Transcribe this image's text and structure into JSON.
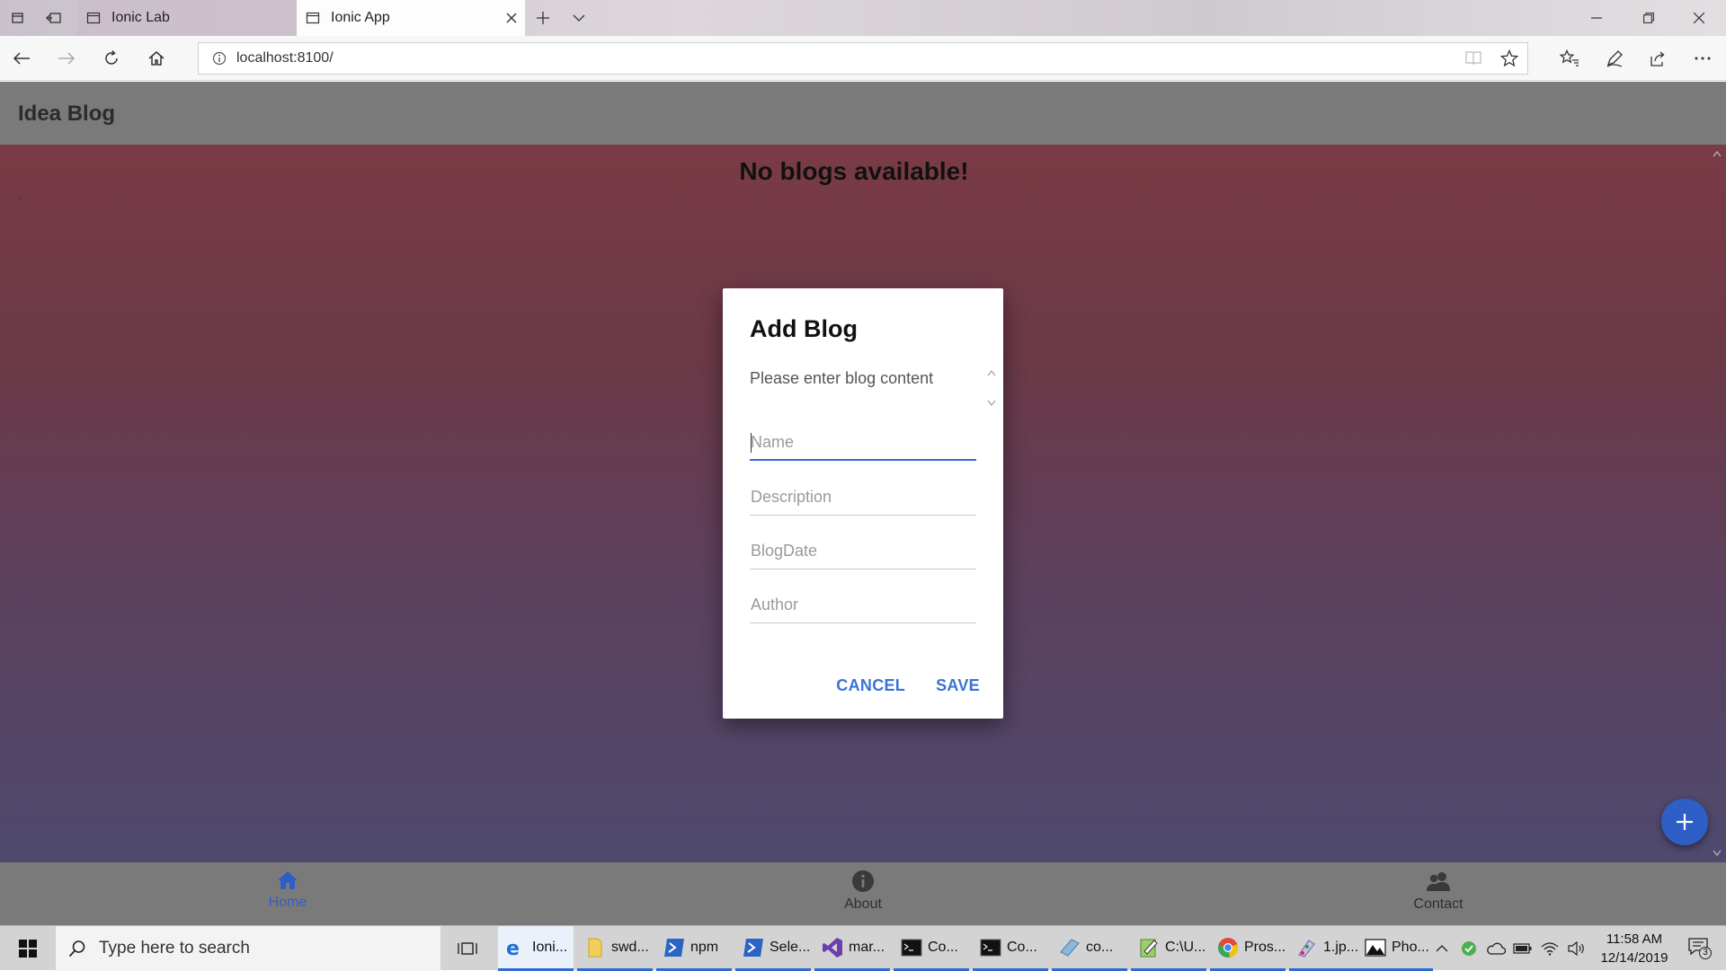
{
  "browser": {
    "tabs": [
      {
        "label": "Ionic Lab"
      },
      {
        "label": "Ionic App"
      }
    ],
    "url": "localhost:8100/"
  },
  "app": {
    "title": "Idea Blog",
    "empty_message": "No blogs available!",
    "stray_mark": "`",
    "tabs": [
      {
        "label": "Home",
        "icon": "home-icon",
        "selected": true
      },
      {
        "label": "About",
        "icon": "info-icon",
        "selected": false
      },
      {
        "label": "Contact",
        "icon": "contacts-icon",
        "selected": false
      }
    ],
    "fab_icon": "add-icon"
  },
  "modal": {
    "title": "Add Blog",
    "message": "Please enter blog content",
    "inputs": [
      {
        "placeholder": "Name",
        "value": ""
      },
      {
        "placeholder": "Description",
        "value": ""
      },
      {
        "placeholder": "BlogDate",
        "value": ""
      },
      {
        "placeholder": "Author",
        "value": ""
      }
    ],
    "cancel_label": "CANCEL",
    "save_label": "SAVE"
  },
  "taskbar": {
    "search_placeholder": "Type here to search",
    "items": [
      {
        "label": "Ioni...",
        "icon": "edge-icon",
        "active": true
      },
      {
        "label": "swd...",
        "icon": "folder-icon",
        "active": false
      },
      {
        "label": "npm",
        "icon": "powershell-icon",
        "active": false
      },
      {
        "label": "Sele...",
        "icon": "powershell-icon",
        "active": false
      },
      {
        "label": "mar...",
        "icon": "visual-studio-icon",
        "active": false
      },
      {
        "label": "Co...",
        "icon": "terminal-icon",
        "active": false
      },
      {
        "label": "Co...",
        "icon": "terminal-icon",
        "active": false
      },
      {
        "label": "co...",
        "icon": "app-icon",
        "active": false
      },
      {
        "label": "C:\\U...",
        "icon": "notepad-icon",
        "active": false
      },
      {
        "label": "Pros...",
        "icon": "chrome-icon",
        "active": false
      },
      {
        "label": "1.jp...",
        "icon": "paint-icon",
        "active": false
      },
      {
        "label": "Pho...",
        "icon": "photos-icon",
        "active": false
      }
    ],
    "time": "11:58 AM",
    "date": "12/14/2019",
    "notification_count": "3"
  },
  "colors": {
    "accent": "#2f6ad0",
    "header": "#7a7a7a",
    "fab": "#2f5fc6"
  }
}
